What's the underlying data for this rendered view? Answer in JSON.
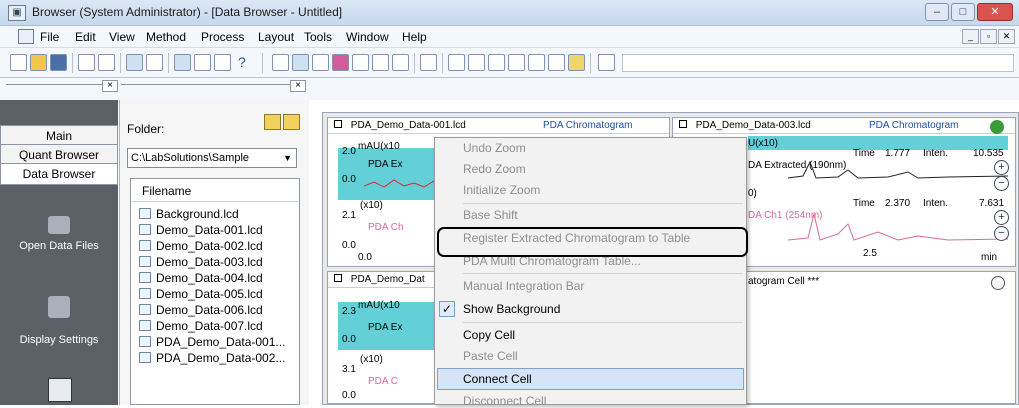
{
  "window": {
    "title": "Browser (System Administrator) - [Data Browser - Untitled]"
  },
  "menu": [
    "File",
    "Edit",
    "View",
    "Method",
    "Process",
    "Layout",
    "Tools",
    "Window",
    "Help"
  ],
  "sidebar": {
    "tabs": [
      "Main",
      "Quant Browser",
      "Data Browser"
    ],
    "items": [
      "Open Data Files",
      "Display Settings"
    ]
  },
  "folder": {
    "label": "Folder:",
    "path": "C:\\LabSolutions\\Sample",
    "column_header": "Filename",
    "files": [
      "Background.lcd",
      "Demo_Data-001.lcd",
      "Demo_Data-002.lcd",
      "Demo_Data-003.lcd",
      "Demo_Data-004.lcd",
      "Demo_Data-005.lcd",
      "Demo_Data-006.lcd",
      "Demo_Data-007.lcd",
      "PDA_Demo_Data-001...",
      "PDA_Demo_Data-002..."
    ]
  },
  "cells": {
    "c1": {
      "file": "PDA_Demo_Data-001.lcd",
      "type": "PDA Chromatogram",
      "unit": "mAU(x10",
      "y_top": "2.0",
      "y_bot": "0.0",
      "trace": "PDA Ex",
      "y2_mult": "(x10)",
      "y2_top": "2.1",
      "y2_bot": "0.0",
      "trace2": "PDA Ch",
      "x0": "0.0"
    },
    "c2": {
      "file": "PDA_Demo_Data-003.lcd",
      "type": "PDA Chromatogram",
      "unit": "U(x10)",
      "time_label": "Time",
      "time1": "1.777",
      "inten_label": "Inten.",
      "inten1": "10.535",
      "trace": "DA Extracted (190nm)",
      "y2_mult": "0)",
      "time2": "2.370",
      "inten2": "7.631",
      "trace2": "DA Ch1 (254nm)",
      "x_tick": "2.5",
      "x_unit": "min"
    },
    "c3": {
      "file": "PDA_Demo_Dat",
      "unit": "mAU(x10",
      "y_top": "2.3",
      "y_bot": "0.0",
      "trace": "PDA Ex",
      "y2_mult": "(x10)",
      "y2_top": "3.1",
      "y2_bot": "0.0",
      "trace2": "PDA C"
    },
    "c4": {
      "text": "atogram Cell ***"
    }
  },
  "context_menu": {
    "items": [
      "Undo Zoom",
      "Redo Zoom",
      "Initialize Zoom",
      "Base Shift",
      "Register Extracted Chromatogram to Table",
      "PDA Multi Chromatogram Table...",
      "Manual Integration Bar",
      "Show Background",
      "Copy Cell",
      "Paste Cell",
      "Connect Cell",
      "Disconnect Cell"
    ]
  },
  "colors": {
    "accent": "#62d0d6",
    "trace": "#e0203a",
    "selection": "#d5e4f7"
  }
}
